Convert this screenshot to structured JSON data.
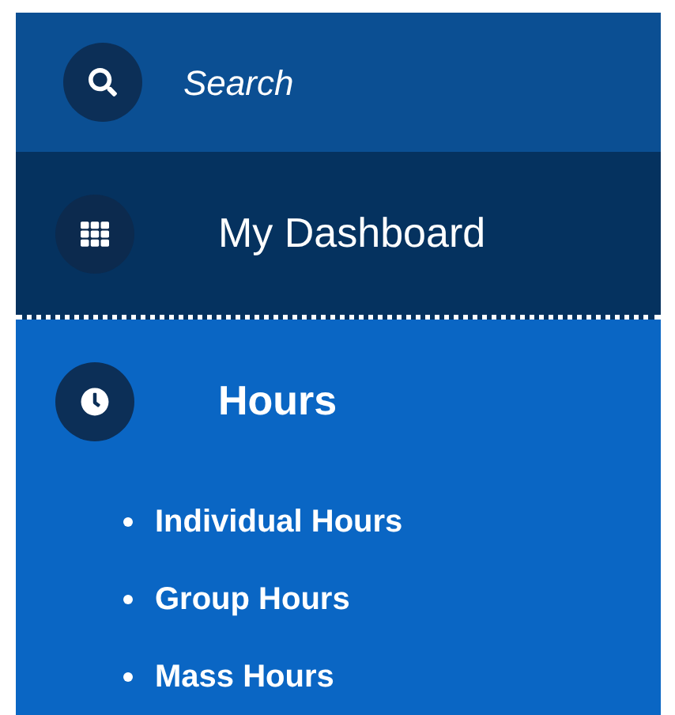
{
  "search": {
    "placeholder": "Search"
  },
  "nav_items": [
    {
      "label": "My Dashboard",
      "kind": "grid",
      "expanded": false
    },
    {
      "label": "Hours",
      "kind": "clock",
      "expanded": true,
      "children": [
        {
          "label": "Individual Hours"
        },
        {
          "label": "Group Hours"
        },
        {
          "label": "Mass Hours"
        }
      ]
    }
  ]
}
